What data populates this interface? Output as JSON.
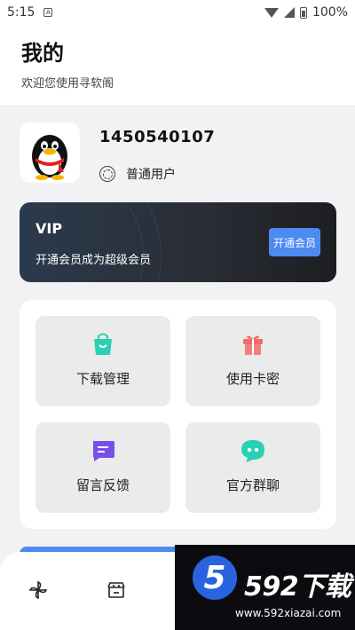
{
  "status_bar": {
    "time": "5:15",
    "sim_letter": "A",
    "battery": "100%"
  },
  "header": {
    "title": "我的",
    "subtitle": "欢迎您使用寻软阁"
  },
  "profile": {
    "username": "1450540107",
    "level": "普通用户"
  },
  "vip": {
    "title": "VIP",
    "description": "开通会员成为超级会员",
    "button": "开通会员"
  },
  "menu": [
    {
      "label": "下载管理",
      "icon": "shopping-bag-icon",
      "color": "#2ad0b4"
    },
    {
      "label": "使用卡密",
      "icon": "gift-icon",
      "color": "#f06a6a"
    },
    {
      "label": "留言反馈",
      "icon": "message-icon",
      "color": "#7a4ee8"
    },
    {
      "label": "官方群聊",
      "icon": "chat-bubble-icon",
      "color": "#2ad0b4"
    }
  ],
  "bottom_nav": [
    {
      "icon": "pinwheel-icon"
    },
    {
      "icon": "shop-icon"
    }
  ],
  "watermark": {
    "brand": "592下载",
    "logo_digit": "5",
    "url": "www.592xiazai.com"
  },
  "colors": {
    "accent": "#4e8bf0",
    "vip_bg": "#2a2e36",
    "page_bg": "#f2f2f4"
  }
}
